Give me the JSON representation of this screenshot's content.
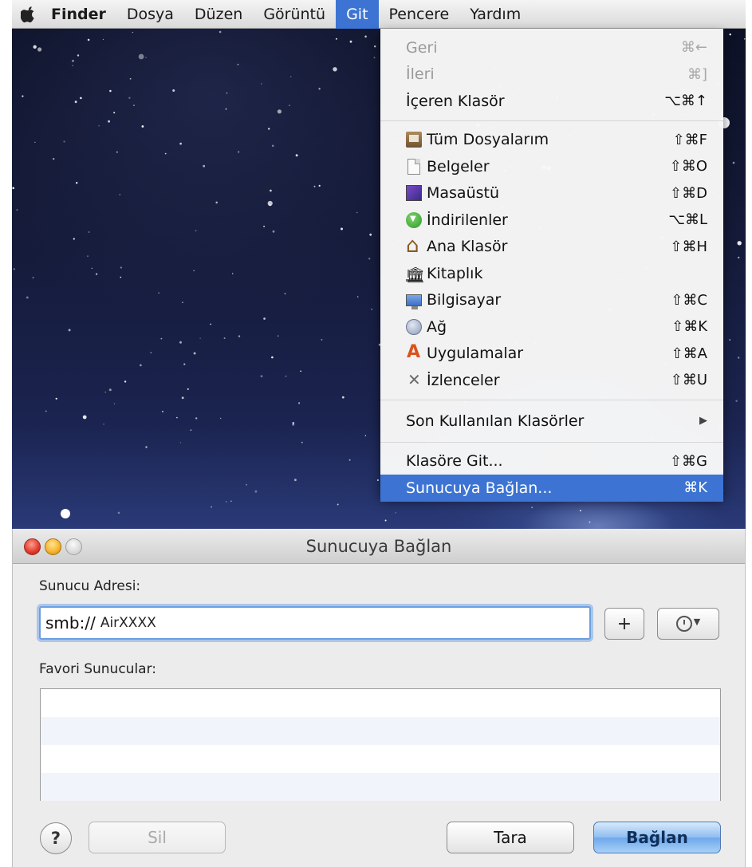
{
  "menubar": {
    "app_name": "Finder",
    "items": [
      "Dosya",
      "Düzen",
      "Görüntü",
      "Git",
      "Pencere",
      "Yardım"
    ],
    "active_item": "Git"
  },
  "go_menu": {
    "section_nav": [
      {
        "label": "Geri",
        "shortcut": "⌘←",
        "disabled": true
      },
      {
        "label": "İleri",
        "shortcut": "⌘]",
        "disabled": true
      },
      {
        "label": "İçeren Klasör",
        "shortcut": "⌥⌘↑",
        "disabled": false
      }
    ],
    "section_places": [
      {
        "label": "Tüm Dosyalarım",
        "shortcut": "⇧⌘F",
        "icon": "all-my-files-icon"
      },
      {
        "label": "Belgeler",
        "shortcut": "⇧⌘O",
        "icon": "documents-icon"
      },
      {
        "label": "Masaüstü",
        "shortcut": "⇧⌘D",
        "icon": "desktop-icon"
      },
      {
        "label": "İndirilenler",
        "shortcut": "⌥⌘L",
        "icon": "downloads-icon"
      },
      {
        "label": "Ana Klasör",
        "shortcut": "⇧⌘H",
        "icon": "home-icon"
      },
      {
        "label": "Kitaplık",
        "shortcut": "",
        "icon": "library-icon"
      },
      {
        "label": "Bilgisayar",
        "shortcut": "⇧⌘C",
        "icon": "computer-icon"
      },
      {
        "label": "Ağ",
        "shortcut": "⇧⌘K",
        "icon": "network-icon"
      },
      {
        "label": "Uygulamalar",
        "shortcut": "⇧⌘A",
        "icon": "applications-icon"
      },
      {
        "label": "İzlenceler",
        "shortcut": "⇧⌘U",
        "icon": "utilities-icon"
      }
    ],
    "recent_folders": {
      "label": "Son Kullanılan Klasörler",
      "submenu_arrow": "▶"
    },
    "goto_folder": {
      "label": "Klasöre Git...",
      "shortcut": "⇧⌘G"
    },
    "connect_server": {
      "label": "Sunucuya Bağlan...",
      "shortcut": "⌘K"
    }
  },
  "dialog": {
    "title": "Sunucuya Bağlan",
    "server_address_label": "Sunucu Adresi:",
    "server_address_scheme": "smb://",
    "server_address_host": "AirXXXX",
    "add_button": "+",
    "favorites_label": "Favori Sunucular:",
    "help_button": "?",
    "remove_button": "Sil",
    "browse_button": "Tara",
    "connect_button": "Bağlan"
  },
  "colors": {
    "menu_highlight": "#3d74d3",
    "close": "#e0392b",
    "minimize": "#f5b12a"
  }
}
